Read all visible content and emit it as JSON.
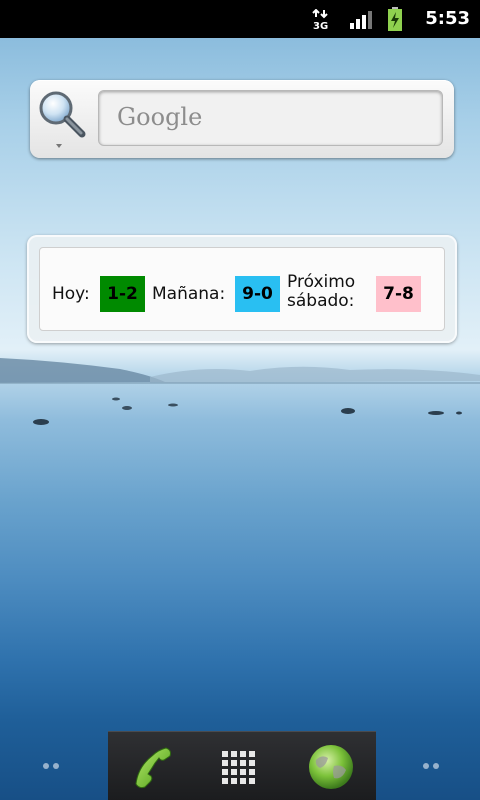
{
  "status_bar": {
    "time": "5:53",
    "network": "3G",
    "icons": [
      "network-3g-icon",
      "signal-icon",
      "battery-charging-icon"
    ]
  },
  "search_widget": {
    "placeholder": "Google",
    "icon": "search-icon"
  },
  "score_widget": {
    "items": [
      {
        "label": "Hoy:",
        "score": "1-2",
        "color": "#008a00"
      },
      {
        "label": "Mañana:",
        "score": "9-0",
        "color": "#29bff2"
      },
      {
        "label_line1": "Próximo",
        "label_line2": "sábado:",
        "score": "7-8",
        "color": "#ffc0cb"
      }
    ]
  },
  "dock": {
    "items": [
      "phone-icon",
      "app-drawer-icon",
      "browser-globe-icon"
    ]
  },
  "colors": {
    "status_bar": "#000000",
    "dock": "#2a2b2e"
  }
}
